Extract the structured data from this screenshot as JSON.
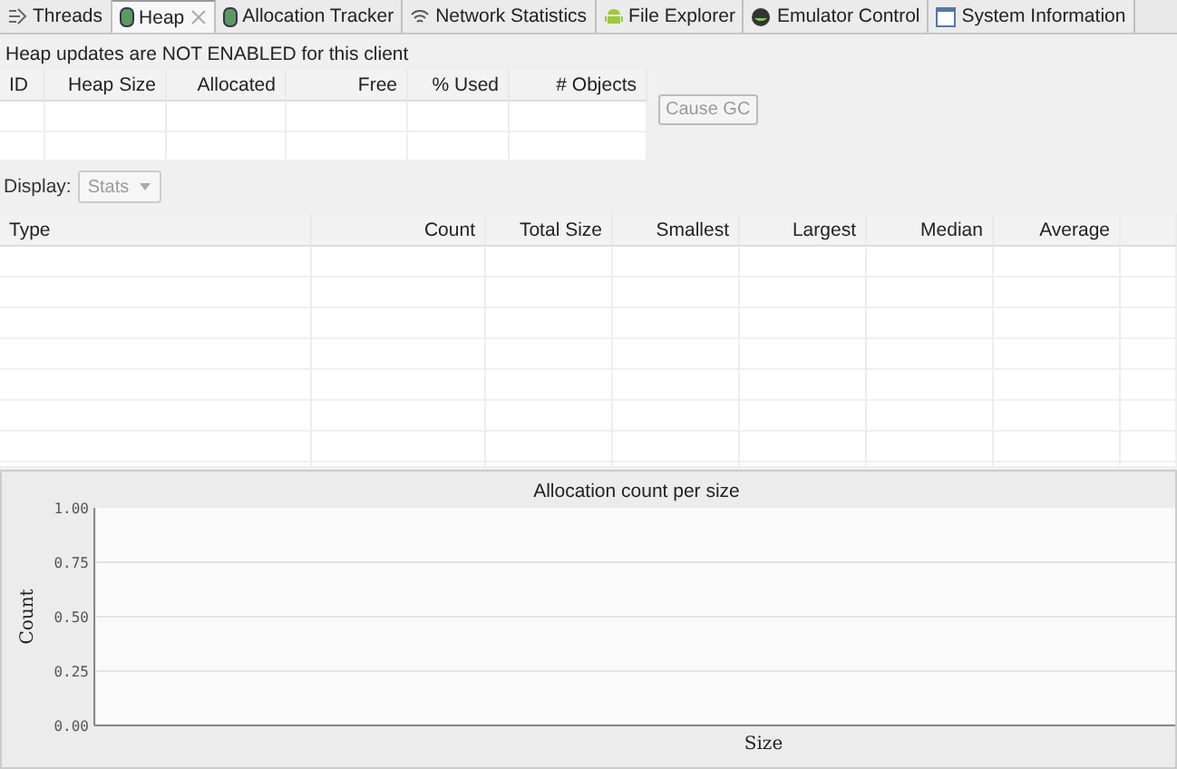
{
  "tabs": [
    {
      "label": "Threads",
      "selected": false,
      "closable": false
    },
    {
      "label": "Heap",
      "selected": true,
      "closable": true
    },
    {
      "label": "Allocation Tracker",
      "selected": false,
      "closable": false
    },
    {
      "label": "Network Statistics",
      "selected": false,
      "closable": false
    },
    {
      "label": "File Explorer",
      "selected": false,
      "closable": false
    },
    {
      "label": "Emulator Control",
      "selected": false,
      "closable": false
    },
    {
      "label": "System Information",
      "selected": false,
      "closable": false
    }
  ],
  "status_message": "Heap updates are NOT ENABLED for this client",
  "heap_table": {
    "columns": [
      "ID",
      "Heap Size",
      "Allocated",
      "Free",
      "% Used",
      "# Objects"
    ]
  },
  "cause_gc_button": {
    "label": "Cause GC",
    "disabled": true
  },
  "display": {
    "label": "Display:",
    "value": "Stats",
    "disabled": true
  },
  "stats_table": {
    "columns": [
      "Type",
      "Count",
      "Total Size",
      "Smallest",
      "Largest",
      "Median",
      "Average"
    ]
  },
  "chart": {
    "title": "Allocation count per size",
    "xlabel": "Size",
    "ylabel": "Count",
    "y_axis_labels": [
      "1.00",
      "0.75",
      "0.50",
      "0.25",
      "0.00"
    ]
  }
}
